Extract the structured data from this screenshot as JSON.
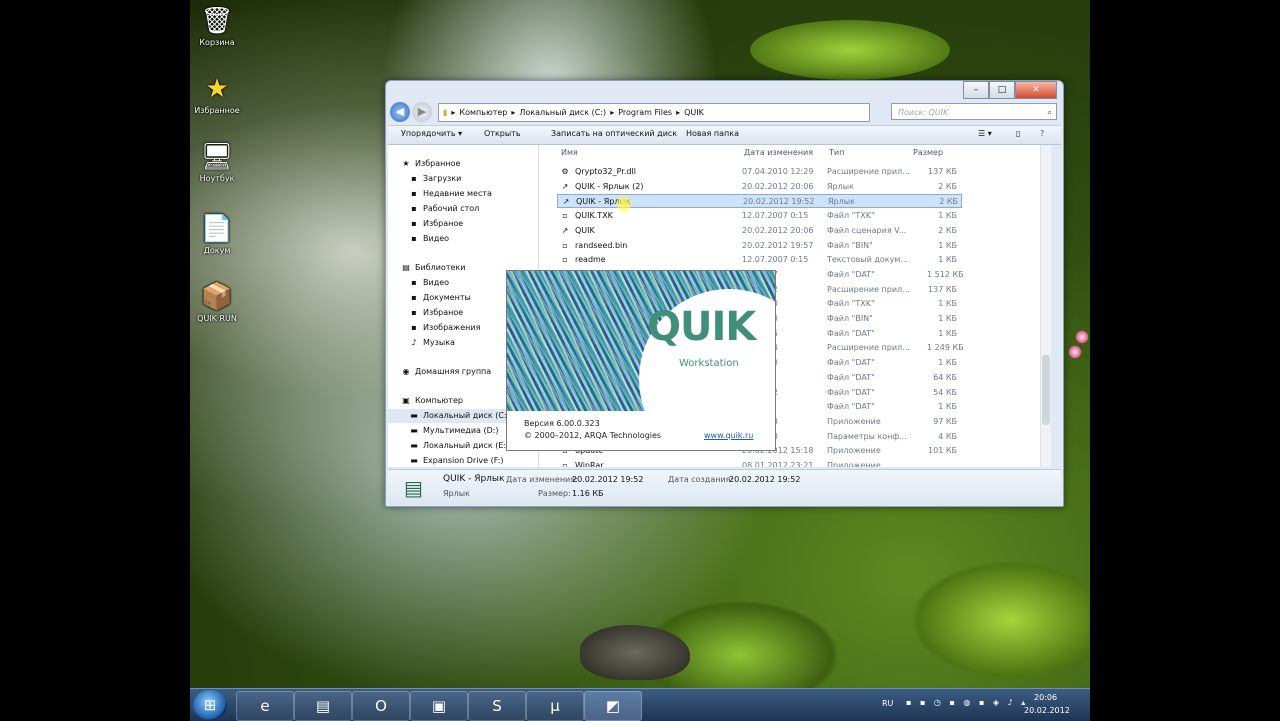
{
  "desktop_icons": [
    {
      "label": "Корзина",
      "glyph": "🗑"
    },
    {
      "label": "Избранное",
      "glyph": "★"
    },
    {
      "label": "Ноутбук",
      "glyph": "🖥"
    },
    {
      "label": "Докум",
      "glyph": "📄"
    },
    {
      "label": "QUIK RUN",
      "glyph": "📦"
    }
  ],
  "window": {
    "address": [
      "Компьютер",
      "Локальный диск (C:)",
      "Program Files",
      "QUIK"
    ],
    "search_placeholder": "Поиск: QUIK",
    "toolbar": {
      "organize": "Упорядочить ▾",
      "open": "Открыть",
      "burn": "Записать на оптический диск",
      "new_folder": "Новая папка"
    },
    "nav": [
      {
        "label": "Избранное",
        "icon": "★"
      },
      {
        "label": "Загрузки",
        "icon": "▪"
      },
      {
        "label": "Недавние места",
        "icon": "▪"
      },
      {
        "label": "Рабочий стол",
        "icon": "▪"
      },
      {
        "label": "Избраное",
        "icon": "▪"
      },
      {
        "label": "Видео",
        "icon": "▪"
      },
      {
        "label": "Библиотеки",
        "icon": "▤"
      },
      {
        "label": "Видео",
        "icon": "▪"
      },
      {
        "label": "Документы",
        "icon": "▪"
      },
      {
        "label": "Избраное",
        "icon": "▪"
      },
      {
        "label": "Изображения",
        "icon": "▪"
      },
      {
        "label": "Музыка",
        "icon": "♪"
      },
      {
        "label": "Домашняя группа",
        "icon": "◉"
      },
      {
        "label": "Компьютер",
        "icon": "▣"
      },
      {
        "label": "Локальный диск (C:)",
        "icon": "▬"
      },
      {
        "label": "Мультимедиа (D:)",
        "icon": "▬"
      },
      {
        "label": "Локальный диск (E:)",
        "icon": "▬"
      },
      {
        "label": "Expansion Drive (F:)",
        "icon": "▬"
      }
    ],
    "columns": {
      "name": "Имя",
      "date": "Дата изменения",
      "type": "Тип",
      "size": "Размер"
    },
    "files": [
      {
        "name": "Qrypto32_Pr.dll",
        "date": "07.04.2010 12:29",
        "type": "Расширение прил...",
        "size": "137 КБ",
        "icon": "⚙"
      },
      {
        "name": "QUIK - Ярлык (2)",
        "date": "20.02.2012 20:06",
        "type": "Ярлык",
        "size": "2 КБ",
        "icon": "↗"
      },
      {
        "name": "QUIK - Ярлык",
        "date": "20.02.2012 19:52",
        "type": "Ярлык",
        "size": "2 КБ",
        "icon": "↗"
      },
      {
        "name": "QUIK.TXK",
        "date": "12.07.2007 0:15",
        "type": "Файл \"TXK\"",
        "size": "1 КБ",
        "icon": "▫"
      },
      {
        "name": "QUIK",
        "date": "20.02.2012 20:06",
        "type": "Файл сценария V...",
        "size": "2 КБ",
        "icon": "↗"
      },
      {
        "name": "randseed.bin",
        "date": "20.02.2012 19:57",
        "type": "Файл \"BIN\"",
        "size": "1 КБ",
        "icon": "▫"
      },
      {
        "name": "readme",
        "date": "12.07.2007 0:15",
        "type": "Текстовый докум...",
        "size": "1 КБ",
        "icon": "▫"
      },
      {
        "name": "",
        "date": "12 19:57",
        "type": "Файл \"DAT\"",
        "size": "1 512 КБ",
        "icon": ""
      },
      {
        "name": "",
        "date": "10 10:12",
        "type": "Расширение прил...",
        "size": "137 КБ",
        "icon": ""
      },
      {
        "name": "",
        "date": "07 19:50",
        "type": "Файл \"TXK\"",
        "size": "1 КБ",
        "icon": ""
      },
      {
        "name": "",
        "date": "12 12:20",
        "type": "Файл \"BIN\"",
        "size": "1 КБ",
        "icon": ""
      },
      {
        "name": "",
        "date": "12 12:15",
        "type": "Файл \"DAT\"",
        "size": "1 КБ",
        "icon": ""
      },
      {
        "name": "",
        "date": "12 11:14",
        "type": "Расширение прил...",
        "size": "1 249 КБ",
        "icon": ""
      },
      {
        "name": "",
        "date": "12 12:20",
        "type": "Файл \"DAT\"",
        "size": "1 КБ",
        "icon": ""
      },
      {
        "name": "",
        "date": "12 9:38",
        "type": "Файл \"DAT\"",
        "size": "64 КБ",
        "icon": ""
      },
      {
        "name": "",
        "date": "12 19:52",
        "type": "Файл \"DAT\"",
        "size": "54 КБ",
        "icon": ""
      },
      {
        "name": "",
        "date": "12 9:38",
        "type": "Файл \"DAT\"",
        "size": "1 КБ",
        "icon": ""
      },
      {
        "name": "",
        "date": "11 23:10",
        "type": "Приложение",
        "size": "97 КБ",
        "icon": ""
      },
      {
        "name": "",
        "date": "11 23:10",
        "type": "Параметры конф...",
        "size": "4 КБ",
        "icon": ""
      },
      {
        "name": "update",
        "date": "20.02.2012 15:18",
        "type": "Приложение",
        "size": "101 КБ",
        "icon": "▫"
      },
      {
        "name": "WinRar",
        "date": "08.01.2012 23:21",
        "type": "Приложение",
        "size": "",
        "icon": "▫"
      }
    ],
    "details": {
      "name": "QUIK - Ярлык",
      "type": "Ярлык",
      "modified_label": "Дата изменения:",
      "modified": "20.02.2012 19:52",
      "size_label": "Размер:",
      "size": "1.16 КБ",
      "created_label": "Дата создания:",
      "created": "20.02.2012 19:52"
    }
  },
  "splash": {
    "logo": "QUIK",
    "subtitle": "Workstation",
    "version": "Версия 6.00.0.323",
    "copyright": "© 2000–2012, ARQA Technologies",
    "link": "www.quik.ru"
  },
  "taskbar": {
    "buttons": [
      {
        "glyph": "e",
        "name": "ie"
      },
      {
        "glyph": "▤",
        "name": "explorer"
      },
      {
        "glyph": "O",
        "name": "outlook"
      },
      {
        "glyph": "▣",
        "name": "monitor"
      },
      {
        "glyph": "S",
        "name": "skype"
      },
      {
        "glyph": "µ",
        "name": "utorrent"
      },
      {
        "glyph": "◩",
        "name": "quik"
      }
    ],
    "lang": "RU",
    "time": "20:06",
    "date": "20.02.2012"
  }
}
